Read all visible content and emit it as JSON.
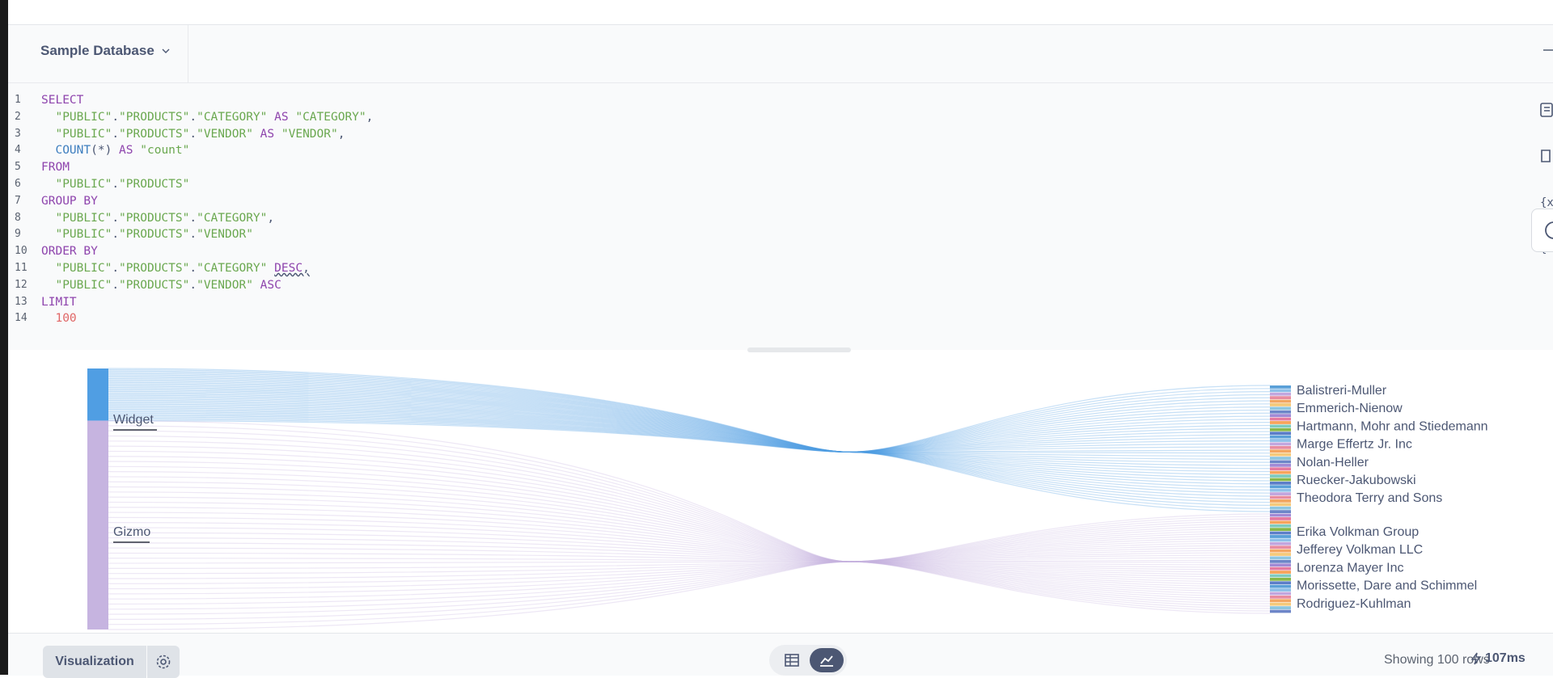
{
  "db_selector": {
    "label": "Sample Database"
  },
  "editor": {
    "lines": [
      [
        {
          "t": "kw",
          "s": "SELECT"
        }
      ],
      [
        {
          "t": "pl",
          "s": "  "
        },
        {
          "t": "str",
          "s": "\"PUBLIC\""
        },
        {
          "t": "pl",
          "s": "."
        },
        {
          "t": "str",
          "s": "\"PRODUCTS\""
        },
        {
          "t": "pl",
          "s": "."
        },
        {
          "t": "str",
          "s": "\"CATEGORY\""
        },
        {
          "t": "pl",
          "s": " "
        },
        {
          "t": "kw",
          "s": "AS"
        },
        {
          "t": "pl",
          "s": " "
        },
        {
          "t": "str",
          "s": "\"CATEGORY\""
        },
        {
          "t": "pl",
          "s": ","
        }
      ],
      [
        {
          "t": "pl",
          "s": "  "
        },
        {
          "t": "str",
          "s": "\"PUBLIC\""
        },
        {
          "t": "pl",
          "s": "."
        },
        {
          "t": "str",
          "s": "\"PRODUCTS\""
        },
        {
          "t": "pl",
          "s": "."
        },
        {
          "t": "str",
          "s": "\"VENDOR\""
        },
        {
          "t": "pl",
          "s": " "
        },
        {
          "t": "kw",
          "s": "AS"
        },
        {
          "t": "pl",
          "s": " "
        },
        {
          "t": "str",
          "s": "\"VENDOR\""
        },
        {
          "t": "pl",
          "s": ","
        }
      ],
      [
        {
          "t": "pl",
          "s": "  "
        },
        {
          "t": "fn",
          "s": "COUNT"
        },
        {
          "t": "pl",
          "s": "(*) "
        },
        {
          "t": "kw",
          "s": "AS"
        },
        {
          "t": "pl",
          "s": " "
        },
        {
          "t": "str",
          "s": "\"count\""
        }
      ],
      [
        {
          "t": "kw",
          "s": "FROM"
        }
      ],
      [
        {
          "t": "pl",
          "s": "  "
        },
        {
          "t": "str",
          "s": "\"PUBLIC\""
        },
        {
          "t": "pl",
          "s": "."
        },
        {
          "t": "str",
          "s": "\"PRODUCTS\""
        }
      ],
      [
        {
          "t": "kw",
          "s": "GROUP BY"
        }
      ],
      [
        {
          "t": "pl",
          "s": "  "
        },
        {
          "t": "str",
          "s": "\"PUBLIC\""
        },
        {
          "t": "pl",
          "s": "."
        },
        {
          "t": "str",
          "s": "\"PRODUCTS\""
        },
        {
          "t": "pl",
          "s": "."
        },
        {
          "t": "str",
          "s": "\"CATEGORY\""
        },
        {
          "t": "pl",
          "s": ","
        }
      ],
      [
        {
          "t": "pl",
          "s": "  "
        },
        {
          "t": "str",
          "s": "\"PUBLIC\""
        },
        {
          "t": "pl",
          "s": "."
        },
        {
          "t": "str",
          "s": "\"PRODUCTS\""
        },
        {
          "t": "pl",
          "s": "."
        },
        {
          "t": "str",
          "s": "\"VENDOR\""
        }
      ],
      [
        {
          "t": "kw",
          "s": "ORDER BY"
        }
      ],
      [
        {
          "t": "pl",
          "s": "  "
        },
        {
          "t": "str",
          "s": "\"PUBLIC\""
        },
        {
          "t": "pl",
          "s": "."
        },
        {
          "t": "str",
          "s": "\"PRODUCTS\""
        },
        {
          "t": "pl",
          "s": "."
        },
        {
          "t": "str",
          "s": "\"CATEGORY\""
        },
        {
          "t": "pl",
          "s": " "
        },
        {
          "t": "kw err",
          "s": "DESC"
        },
        {
          "t": "pl err",
          "s": ","
        }
      ],
      [
        {
          "t": "pl",
          "s": "  "
        },
        {
          "t": "str",
          "s": "\"PUBLIC\""
        },
        {
          "t": "pl",
          "s": "."
        },
        {
          "t": "str",
          "s": "\"PRODUCTS\""
        },
        {
          "t": "pl",
          "s": "."
        },
        {
          "t": "str",
          "s": "\"VENDOR\""
        },
        {
          "t": "pl",
          "s": " "
        },
        {
          "t": "kw",
          "s": "ASC"
        }
      ],
      [
        {
          "t": "kw",
          "s": "LIMIT"
        }
      ],
      [
        {
          "t": "pl",
          "s": "  "
        },
        {
          "t": "num",
          "s": "100"
        }
      ]
    ]
  },
  "chart_data": {
    "type": "sankey",
    "sources": [
      {
        "name": "Widget",
        "color": "#509ee3",
        "label": "Widget",
        "share": 0.2,
        "hub_frac": 0.32
      },
      {
        "name": "Gizmo",
        "color": "#c6b4e0",
        "label": "Gizmo",
        "share": 0.8,
        "hub_frac": 0.74
      }
    ],
    "source_labels": [
      "Widget",
      "Gizmo"
    ],
    "target_labels_group1": [
      "Balistreri-Muller",
      "Emmerich-Nienow",
      "Hartmann, Mohr and Stiedemann",
      "Marge Effertz Jr. Inc",
      "Nolan-Heller",
      "Ruecker-Jakubowski",
      "Theodora Terry and Sons"
    ],
    "target_labels_group2": [
      "Erika Volkman Group",
      "Jefferey Volkman LLC",
      "Lorenza Mayer Inc",
      "Morissette, Dare and Schimmel",
      "Rodriguez-Kuhlman"
    ],
    "target_swatch_palette": [
      "#5aa0d8",
      "#8fc0e8",
      "#c2a6de",
      "#e88da0",
      "#f2a662",
      "#f5c97a",
      "#8ec6e0",
      "#6d86c8",
      "#a18ad6",
      "#e47aa0",
      "#f7a45c",
      "#7fcbbf",
      "#88b84a",
      "#5c7ec8"
    ]
  },
  "footer": {
    "viz_label": "Visualization",
    "rows_text": "Showing 100 rows",
    "timing": "107ms"
  },
  "colors": {
    "accent": "#509ee3",
    "text": "#4c5773"
  }
}
